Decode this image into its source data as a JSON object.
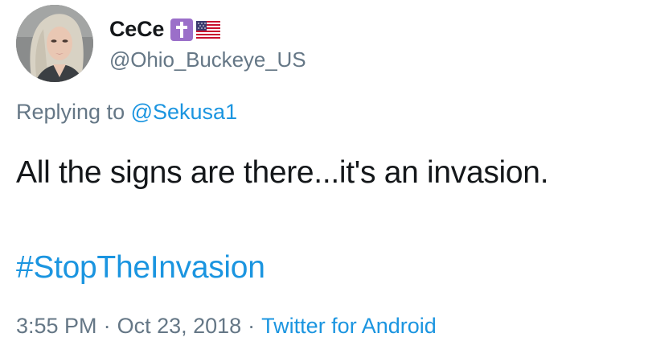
{
  "author": {
    "display_name": "CeCe",
    "handle": "@Ohio_Buckeye_US",
    "badges": [
      "latin-cross-emoji-icon",
      "us-flag-emoji-icon"
    ]
  },
  "reply": {
    "prefix": "Replying to",
    "to_handle": "@Sekusa1"
  },
  "tweet": {
    "text": "All the signs are there...it's an invasion.",
    "hashtag": "#StopTheInvasion"
  },
  "meta": {
    "time": "3:55 PM",
    "separator": "·",
    "date": "Oct 23, 2018",
    "source": "Twitter for Android"
  },
  "colors": {
    "link": "#1b95e0",
    "secondary_text": "#657786",
    "primary_text": "#14171a",
    "background": "#ffffff"
  }
}
